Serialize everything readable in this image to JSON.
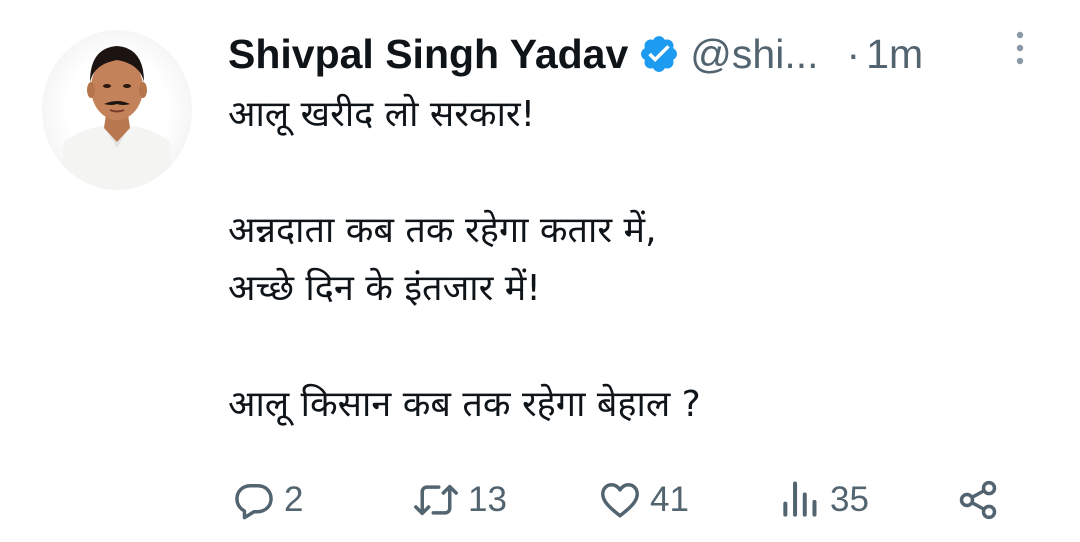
{
  "tweet": {
    "display_name": "Shivpal Singh Yadav",
    "handle": "@shi...",
    "separator": "·",
    "time": "1m",
    "text": "आलू खरीद लो सरकार!\n\nअन्नदाता कब तक रहेगा कतार में,\nअच्छे दिन के इंतजार में!\n\nआलू किसान कब तक रहेगा बेहाल ?"
  },
  "actions": {
    "replies": "2",
    "retweets": "13",
    "likes": "41",
    "views": "35"
  },
  "colors": {
    "verified": "#1d9bf0",
    "text": "#0f1419",
    "muted": "#536471"
  },
  "icons": {
    "verified": "verified-badge-icon",
    "more": "more-vertical-icon",
    "reply": "reply-icon",
    "retweet": "retweet-icon",
    "like": "heart-icon",
    "views": "views-bar-icon",
    "share": "share-icon"
  }
}
